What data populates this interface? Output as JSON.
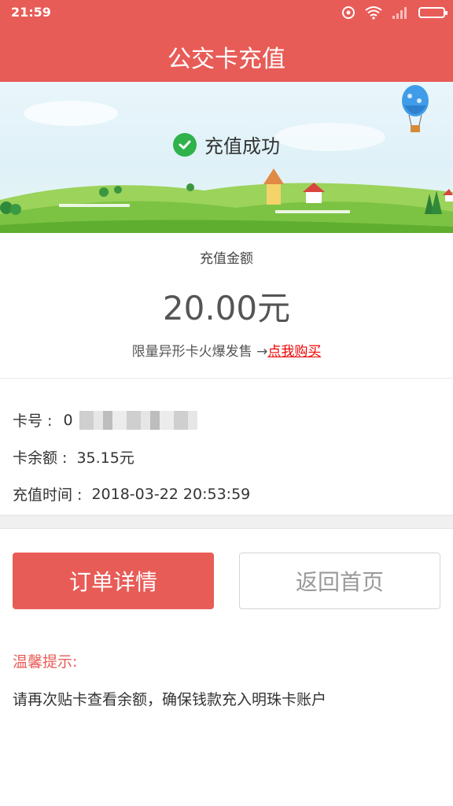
{
  "status_bar": {
    "time": "21:59"
  },
  "header": {
    "title": "公交卡充值"
  },
  "banner": {
    "success_text": "充值成功"
  },
  "amount": {
    "label": "充值金额",
    "value": "20.00元"
  },
  "promo": {
    "text": "限量异形卡火爆发售 →",
    "link": "点我购买"
  },
  "card_info": {
    "card_no_label": "卡号 :",
    "card_no_value": "0",
    "balance_label": "卡余额 :",
    "balance_value": "35.15元",
    "time_label": "充值时间 :",
    "time_value": "2018-03-22 20:53:59"
  },
  "buttons": {
    "detail": "订单详情",
    "home": "返回首页"
  },
  "tips": {
    "title": "温馨提示:",
    "body": "请再次贴卡查看余额，确保钱款充入明珠卡账户"
  },
  "colors": {
    "primary": "#e85c57",
    "success": "#2fb24a",
    "link": "#ee0000"
  }
}
